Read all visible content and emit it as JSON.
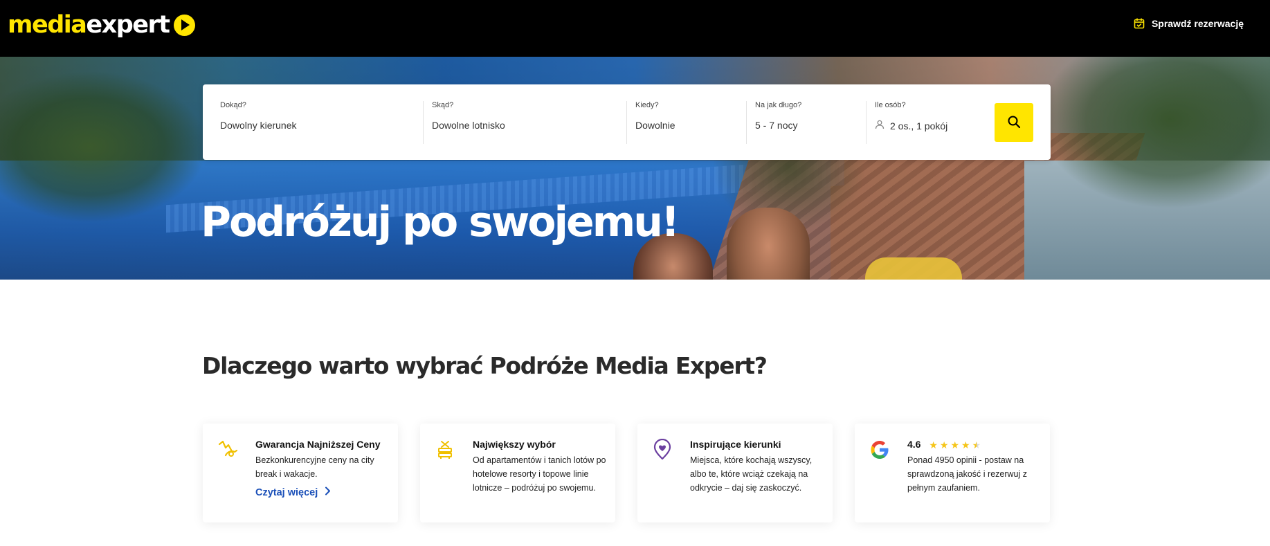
{
  "header": {
    "logo_part1": "media",
    "logo_part2": "expert",
    "reservation_label": "Sprawdź rezerwację"
  },
  "search": {
    "fields": [
      {
        "label": "Dokąd?",
        "value": "Dowolny kierunek"
      },
      {
        "label": "Skąd?",
        "value": "Dowolne lotnisko"
      },
      {
        "label": "Kiedy?",
        "value": "Dowolnie"
      },
      {
        "label": "Na jak długo?",
        "value": "5 - 7 nocy"
      },
      {
        "label": "Ile osób?",
        "value": "2 os., 1 pokój"
      }
    ],
    "button_icon": "search-icon"
  },
  "hero": {
    "title": "Podróżuj po swojemu!"
  },
  "why": {
    "title": "Dlaczego warto wybrać Podróże Media Expert?",
    "cards": [
      {
        "icon": "lowest-price-icon",
        "title": "Gwarancja Najniższej Ceny",
        "text": "Bezkonkurencyjne ceny na city break i wakacje.",
        "link": "Czytaj więcej"
      },
      {
        "icon": "beach-chair-icon",
        "title": "Największy wybór",
        "text": "Od apartamentów i tanich lotów po hotelowe resorty i topowe linie lotnicze – podróżuj po swojemu."
      },
      {
        "icon": "heart-location-icon",
        "title": "Inspirujące kierunki",
        "text": "Miejsca, które kochają wszyscy, albo te, które wciąż czekają na odkrycie – daj się zaskoczyć."
      },
      {
        "icon": "google-icon",
        "rating": "4.6",
        "text": "Ponad 4950 opinii - postaw na sprawdzoną jakość i rezerwuj z pełnym zaufaniem."
      }
    ]
  },
  "colors": {
    "brand_yellow": "#ffe500",
    "link_blue": "#1a4fb8",
    "star": "#f5c518",
    "icon_yellow": "#f0c000",
    "icon_purple": "#6b3fa0"
  }
}
